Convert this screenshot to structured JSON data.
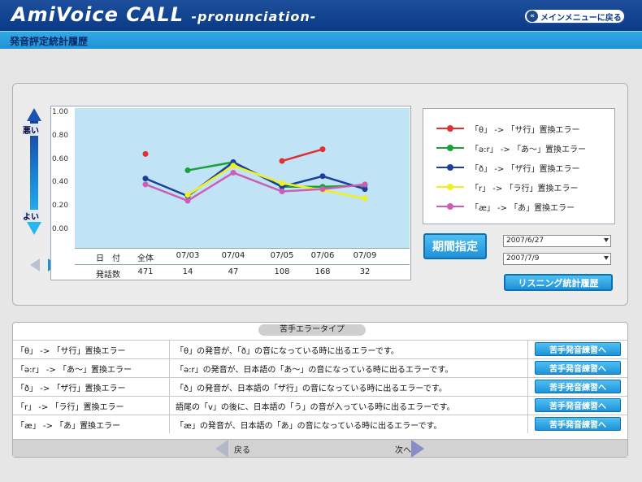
{
  "header": {
    "app_title": "AmiVoice CALL",
    "app_subtitle": "-pronunciation-",
    "main_menu_label": "メインメニューに戻る"
  },
  "page_title": "発音評定統計履歴",
  "axis": {
    "bad_label": "悪い",
    "good_label": "よい"
  },
  "chart_data": {
    "type": "line",
    "ylim": [
      0,
      1
    ],
    "yticks": [
      "1.00",
      "0.80",
      "0.60",
      "0.40",
      "0.20",
      "0.00"
    ],
    "categories": [
      "全体",
      "07/03",
      "07/04",
      "07/05",
      "07/06",
      "07/09"
    ],
    "x_header": "日　付",
    "count_header": "発話数",
    "counts": [
      "471",
      "14",
      "47",
      "108",
      "168",
      "32"
    ],
    "series": [
      {
        "name": "「θ」 -> 「サ行」置換エラー",
        "color": "#e03030",
        "values": [
          0.65,
          null,
          null,
          0.59,
          0.69,
          null
        ]
      },
      {
        "name": "「ə:r」 -> 「あ〜」置換エラー",
        "color": "#1aa13a",
        "values": [
          null,
          0.51,
          0.58,
          0.37,
          0.37,
          0.38
        ]
      },
      {
        "name": "「ð」 -> 「ザ行」置換エラー",
        "color": "#1c3f9a",
        "values": [
          0.44,
          0.29,
          0.58,
          0.37,
          0.46,
          0.35
        ]
      },
      {
        "name": "「r」 -> 「ラ行」置換エラー",
        "color": "#f0f020",
        "values": [
          null,
          0.3,
          0.55,
          0.4,
          0.34,
          0.27
        ]
      },
      {
        "name": "「æ」 -> 「あ」置換エラー",
        "color": "#cc5fb5",
        "values": [
          0.39,
          0.25,
          0.49,
          0.33,
          0.35,
          0.39
        ]
      }
    ]
  },
  "period": {
    "button_label": "期間指定",
    "start_date": "2007/6/27",
    "end_date": "2007/7/9"
  },
  "listening_button_label": "リスニング統計履歴",
  "error_table": {
    "header": "苦手エラータイプ",
    "rows": [
      {
        "type": "「θ」 -> 「サ行」置換エラー",
        "desc": "「θ」の発音が、「ð」の音になっている時に出るエラーです。",
        "button": "苦手発音練習へ"
      },
      {
        "type": "「ə:r」 -> 「あ〜」置換エラー",
        "desc": "「ə:r」の発音が、日本語の「あ〜」の音になっている時に出るエラーです。",
        "button": "苦手発音練習へ"
      },
      {
        "type": "「ð」 -> 「ザ行」置換エラー",
        "desc": "「ð」の発音が、日本語の「ザ行」の音になっている時に出るエラーです。",
        "button": "苦手発音練習へ"
      },
      {
        "type": "「r」 -> 「ラ行」置換エラー",
        "desc": "語尾の「v」の後に、日本語の「う」の音が入っている時に出るエラーです。",
        "button": "苦手発音練習へ"
      },
      {
        "type": "「æ」 -> 「あ」置換エラー",
        "desc": "「æ」の発音が、日本語の「あ」の音になっている時に出るエラーです。",
        "button": "苦手発音練習へ"
      }
    ]
  },
  "footer": {
    "back_label": "戻る",
    "next_label": "次へ"
  }
}
